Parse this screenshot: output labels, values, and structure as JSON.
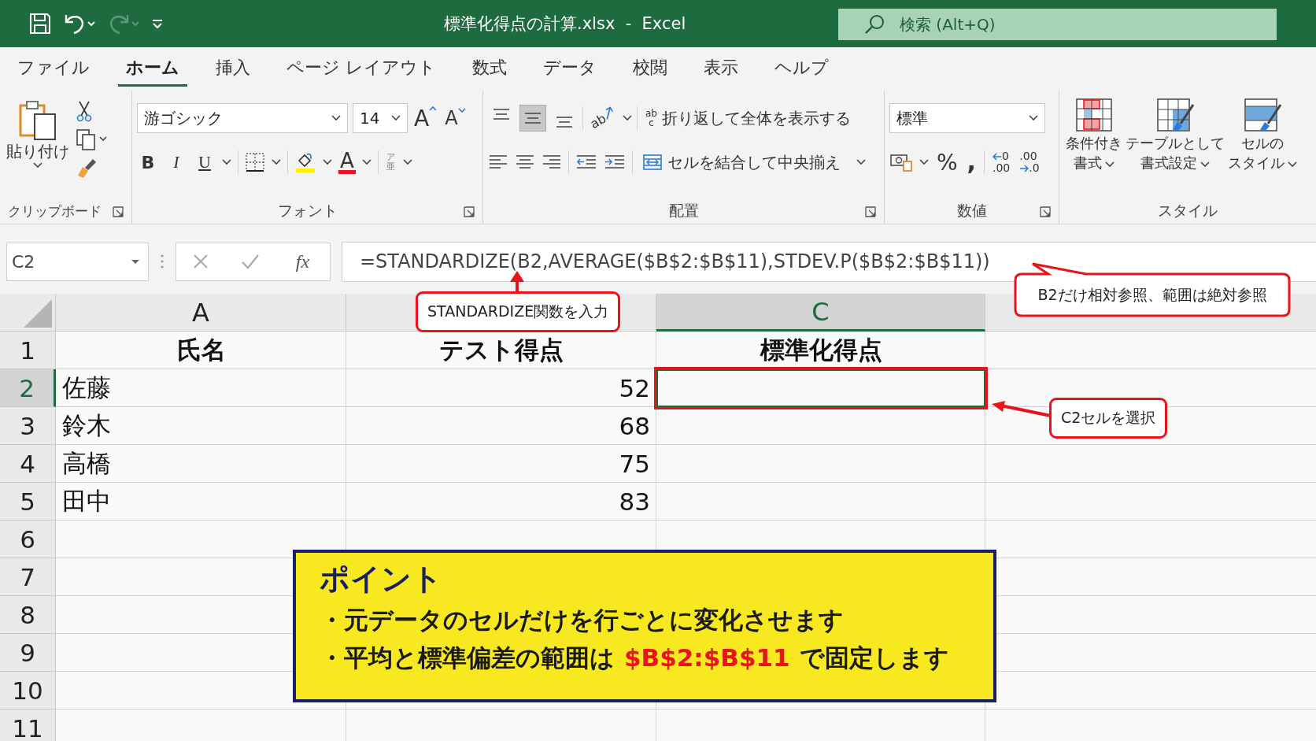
{
  "title_bar": {
    "quick_access": [
      {
        "kind": "save",
        "disabled": false
      },
      {
        "kind": "undo",
        "disabled": false
      },
      {
        "kind": "redo",
        "disabled": true
      },
      {
        "kind": "customize",
        "disabled": false
      }
    ],
    "title": "標準化得点の計算.xlsx  -  Excel",
    "search": {
      "placeholder": "検索 (Alt+Q)"
    }
  },
  "tabs": [
    {
      "label": "ファイル",
      "selected": false
    },
    {
      "label": "ホーム",
      "selected": true
    },
    {
      "label": "挿入",
      "selected": false
    },
    {
      "label": "ページ レイアウト",
      "selected": false
    },
    {
      "label": "数式",
      "selected": false
    },
    {
      "label": "データ",
      "selected": false
    },
    {
      "label": "校閲",
      "selected": false
    },
    {
      "label": "表示",
      "selected": false
    },
    {
      "label": "ヘルプ",
      "selected": false
    }
  ],
  "ribbon": {
    "clipboard": {
      "paste_label": "貼り付け",
      "group_label": "クリップボード"
    },
    "font": {
      "font_name": "游ゴシック",
      "font_size": "14",
      "grow_glyph": "A",
      "shrink_glyph": "A",
      "format_buttons": [
        {
          "kind": "bold",
          "glyph": "B"
        },
        {
          "kind": "italic",
          "glyph": "I"
        },
        {
          "kind": "underline",
          "glyph": "U"
        }
      ],
      "font_color_glyph": "A",
      "phonetic_glyphs": [
        "ア",
        "亜"
      ],
      "group_label": "フォント"
    },
    "alignment": {
      "vertical": [
        {
          "kind": "top",
          "selected": false
        },
        {
          "kind": "middle",
          "selected": true
        },
        {
          "kind": "bottom",
          "selected": false
        }
      ],
      "orientation_glyph": "ab",
      "wrap_glyphs": [
        "ab",
        "c"
      ],
      "wrap_text": "折り返して全体を表示する",
      "merge": "セルを結合して中央揃え",
      "group_label": "配置"
    },
    "number": {
      "format": "標準",
      "percent_glyph": "%",
      "comma_glyph": ",",
      "increase_decimal": [
        "0",
        ".00"
      ],
      "decrease_decimal": [
        ".00",
        ".0"
      ],
      "group_label": "数値"
    },
    "styles": {
      "buttons": [
        {
          "kind": "conditional",
          "lines": [
            "条件付き",
            "書式"
          ]
        },
        {
          "kind": "table",
          "lines": [
            "テーブルとして",
            "書式設定"
          ]
        },
        {
          "kind": "cell",
          "lines": [
            "セルの",
            "スタイル"
          ]
        }
      ],
      "group_label": "スタイル"
    }
  },
  "formula_bar": {
    "name_box": "C2",
    "fx": "fx",
    "formula": "=STANDARDIZE(B2,AVERAGE($B$2:$B$11),STDEV.P($B$2:$B$11))"
  },
  "sheet": {
    "columns": [
      {
        "label": "A",
        "selected": false
      },
      {
        "selected": false
      },
      {
        "label": "C",
        "selected": true
      }
    ],
    "rows": [
      {
        "number": "1",
        "selected": false,
        "kind": "header",
        "a": "氏名",
        "b": "テスト得点",
        "c": "標準化得点"
      },
      {
        "number": "2",
        "selected": true,
        "kind": "data",
        "a": "佐藤",
        "b": "52"
      },
      {
        "number": "3",
        "selected": false,
        "kind": "data",
        "a": "鈴木",
        "b": "68"
      },
      {
        "number": "4",
        "selected": false,
        "kind": "data",
        "a": "高橋",
        "b": "75"
      },
      {
        "number": "5",
        "selected": false,
        "kind": "data",
        "a": "田中",
        "b": "83"
      },
      {
        "number": "6",
        "selected": false
      },
      {
        "number": "7",
        "selected": false
      },
      {
        "number": "8",
        "selected": false
      },
      {
        "number": "9",
        "selected": false
      },
      {
        "number": "10",
        "selected": false
      },
      {
        "number": "11",
        "selected": false
      }
    ]
  },
  "callouts": [
    {
      "kind": "arrow_up",
      "text": "STANDARDIZE関数を入力"
    },
    {
      "kind": "speech",
      "text": "B2だけ相対参照、範囲は絶対参照"
    },
    {
      "kind": "arrow_left",
      "text": "C2セルを選択"
    }
  ],
  "point_box": {
    "title": "ポイント",
    "lines": [
      [
        {
          "text": "・元データのセルだけを行ごとに変化させます",
          "highlight": false
        }
      ],
      [
        {
          "text": "・平均と標準偏差の範囲は",
          "highlight": false
        },
        {
          "text": "$B$2:$B$11",
          "highlight": true
        },
        {
          "text": "で固定します",
          "highlight": false
        }
      ]
    ]
  }
}
